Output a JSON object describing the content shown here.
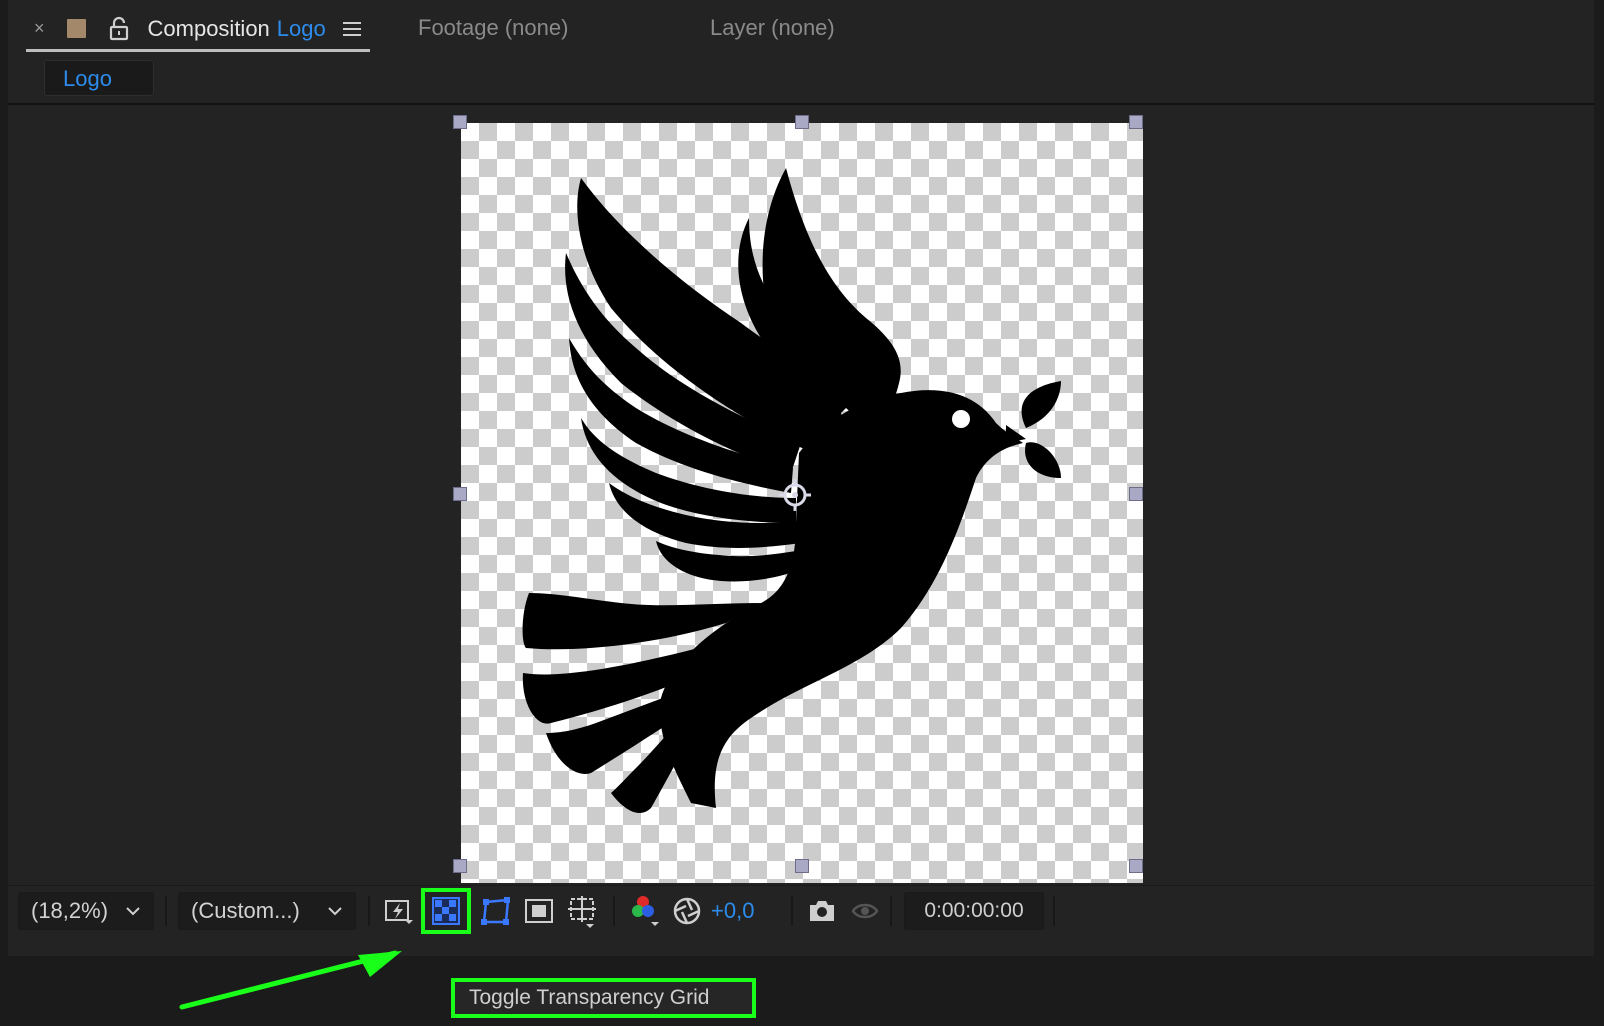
{
  "tabs": {
    "composition": {
      "label": "Composition",
      "name": "Logo"
    },
    "footage": "Footage (none)",
    "layer": "Layer (none)",
    "close_glyph": "×"
  },
  "breadcrumb": "Logo",
  "toolbar": {
    "zoom": "(18,2%)",
    "resolution": "(Custom...)",
    "exposure": "+0,0",
    "timecode": "0:00:00:00"
  },
  "tooltip": "Toggle Transparency Grid",
  "colors": {
    "accent_blue": "#2d8ceb",
    "highlight_green": "#19ff19",
    "comp_label_swatch": "#a3896a"
  },
  "icons": [
    "lock-icon",
    "panel-menu-icon",
    "fast-preview-icon",
    "transparency-grid-icon",
    "region-of-interest-icon",
    "mask-visibility-icon",
    "grid-guides-icon",
    "color-channels-icon",
    "exposure-icon",
    "camera-snapshot-icon",
    "show-snapshot-icon"
  ]
}
